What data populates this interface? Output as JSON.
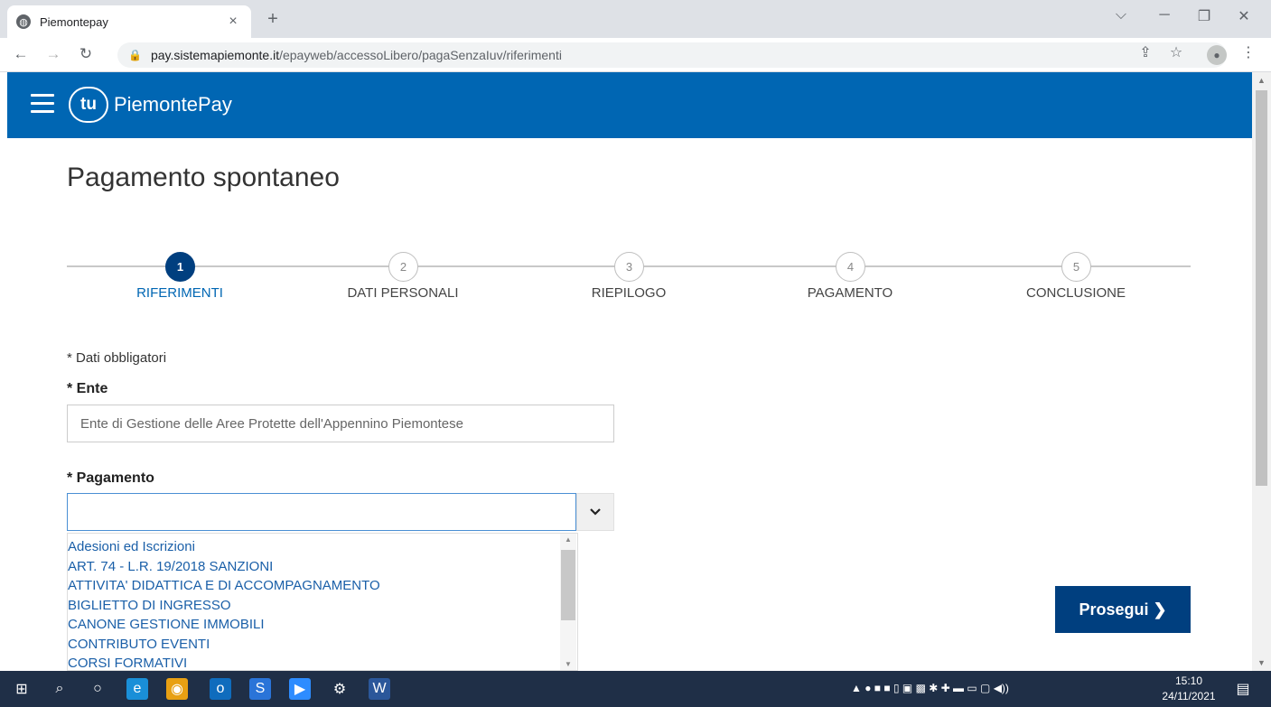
{
  "browser": {
    "tab_title": "Piemontepay",
    "tab_close": "×",
    "new_tab": "+",
    "url_host": "pay.sistemapiemonte.it",
    "url_path": "/epayweb/accessoLibero/pagaSenzaIuv/riferimenti",
    "minimize": "─",
    "maximize": "❐",
    "close": "✕",
    "dropdown_glyph": "⌵"
  },
  "app": {
    "logo_mark": "tu",
    "brand": "PiemontePay"
  },
  "page": {
    "title": "Pagamento spontaneo",
    "required_note": "* Dati obbligatori",
    "ente_label": "* Ente",
    "ente_value": "Ente di Gestione delle Aree Protette dell'Appennino Piemontese",
    "pagamento_label": "* Pagamento",
    "pagamento_value": "",
    "continue_button": "Prosegui ❯"
  },
  "stepper": {
    "steps": [
      {
        "number": "1",
        "label": "RIFERIMENTI",
        "active": true
      },
      {
        "number": "2",
        "label": "DATI PERSONALI",
        "active": false
      },
      {
        "number": "3",
        "label": "RIEPILOGO",
        "active": false
      },
      {
        "number": "4",
        "label": "PAGAMENTO",
        "active": false
      },
      {
        "number": "5",
        "label": "CONCLUSIONE",
        "active": false
      }
    ]
  },
  "pagamento_options": [
    "Adesioni ed Iscrizioni",
    "ART. 74 - L.R. 19/2018 SANZIONI",
    "ATTIVITA' DIDATTICA E DI ACCOMPAGNAMENTO",
    "BIGLIETTO DI INGRESSO",
    "CANONE GESTIONE IMMOBILI",
    "CONTRIBUTO EVENTI",
    "CORSI FORMATIVI"
  ],
  "taskbar": {
    "time": "15:10",
    "date": "24/11/2021"
  },
  "colors": {
    "brand_blue": "#0066b3",
    "dark_blue": "#003f7f"
  }
}
